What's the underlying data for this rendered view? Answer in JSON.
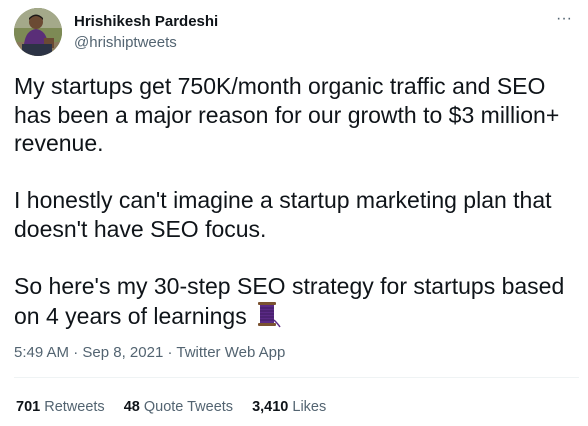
{
  "author": {
    "display_name": "Hrishikesh Pardeshi",
    "handle": "@hrishiptweets"
  },
  "icons": {
    "more": "more-horizontal-icon",
    "thread": "spool-of-thread-emoji"
  },
  "tweet": {
    "paragraphs": [
      "My startups get 750K/month organic traffic and SEO has been a major reason for our growth to $3 million+ revenue.",
      "I honestly can't imagine a startup marketing plan that doesn't have SEO focus.",
      "So here's my 30-step SEO strategy for startups based on 4 years of learnings"
    ],
    "time": "5:49 AM",
    "date": "Sep 8, 2021",
    "source": "Twitter Web App",
    "separator": "·"
  },
  "stats": {
    "retweets_count": "701",
    "retweets_label": "Retweets",
    "quote_tweets_count": "48",
    "quote_tweets_label": "Quote Tweets",
    "likes_count": "3,410",
    "likes_label": "Likes"
  },
  "colors": {
    "primary_text": "#0f1419",
    "secondary_text": "#536471",
    "divider": "#eff3f4",
    "thread_emoji": "#5b2a86"
  }
}
